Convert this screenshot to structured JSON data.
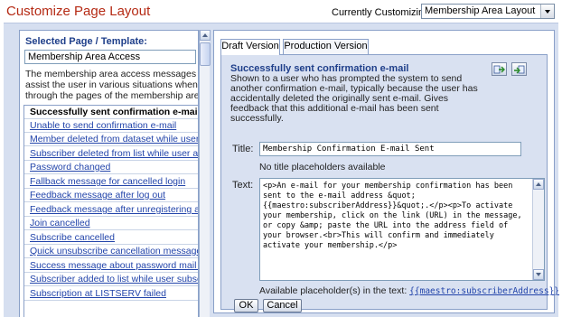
{
  "header": {
    "title": "Customize Page Layout",
    "customizing_label": "Currently Customizing:",
    "customizing_value": "Membership Area Layout"
  },
  "left": {
    "heading": "Selected Page / Template:",
    "selected_value": "Membership Area Access",
    "description_lines": [
      "The membership area access messages are used",
      "assist the user in various situations when navigati",
      "through the pages of the membership area."
    ],
    "items": [
      "Successfully sent confirmation e-mail",
      "Unable to send confirmation e-mail",
      "Member deleted from dataset while user active",
      "Subscriber deleted from list while user active",
      "Password changed",
      "Fallback message for cancelled login",
      "Feedback message after log out",
      "Feedback message after unregistering a user",
      "Join cancelled",
      "Subscribe cancelled",
      "Quick unsubscribe cancellation message",
      "Success message about password mail delivery",
      "Subscriber added to list while user subscribes",
      "Subscription at LISTSERV failed"
    ],
    "selected_index": 0
  },
  "tabs": [
    "Draft Version",
    "Production Version"
  ],
  "active_tab": 0,
  "editor": {
    "title": "Successfully sent confirmation e-mail",
    "description": "Shown to a user who has prompted the system to send another confirmation e-mail, typically because the user has accidentally deleted the originally sent e-mail. Gives feedback that this additional e-mail has been sent successfully.",
    "title_label": "Title:",
    "title_value": "Membership Confirmation E-mail Sent",
    "title_hint": "No title placeholders available",
    "text_label": "Text:",
    "text_value": "<p>An e-mail for your membership confirmation has been sent to the e-mail address &quot;{{maestro:subscriberAddress}}&quot;.</p><p>To activate your membership, click on the link (URL) in the message, or copy &amp; paste the URL into the address field of your browser.<br>This will confirm and immediately activate your membership.</p>",
    "placeholders_label": "Available placeholder(s) in the text:",
    "placeholder": "{{maestro:subscriberAddress}}",
    "ok_label": "OK",
    "cancel_label": "Cancel"
  },
  "icons": [
    "revert-icon",
    "publish-icon"
  ],
  "colors": {
    "title_red": "#b52a14",
    "heading_blue": "#1f3f8a",
    "link_blue": "#2244aa",
    "panel_bg": "#d9e1f1"
  }
}
